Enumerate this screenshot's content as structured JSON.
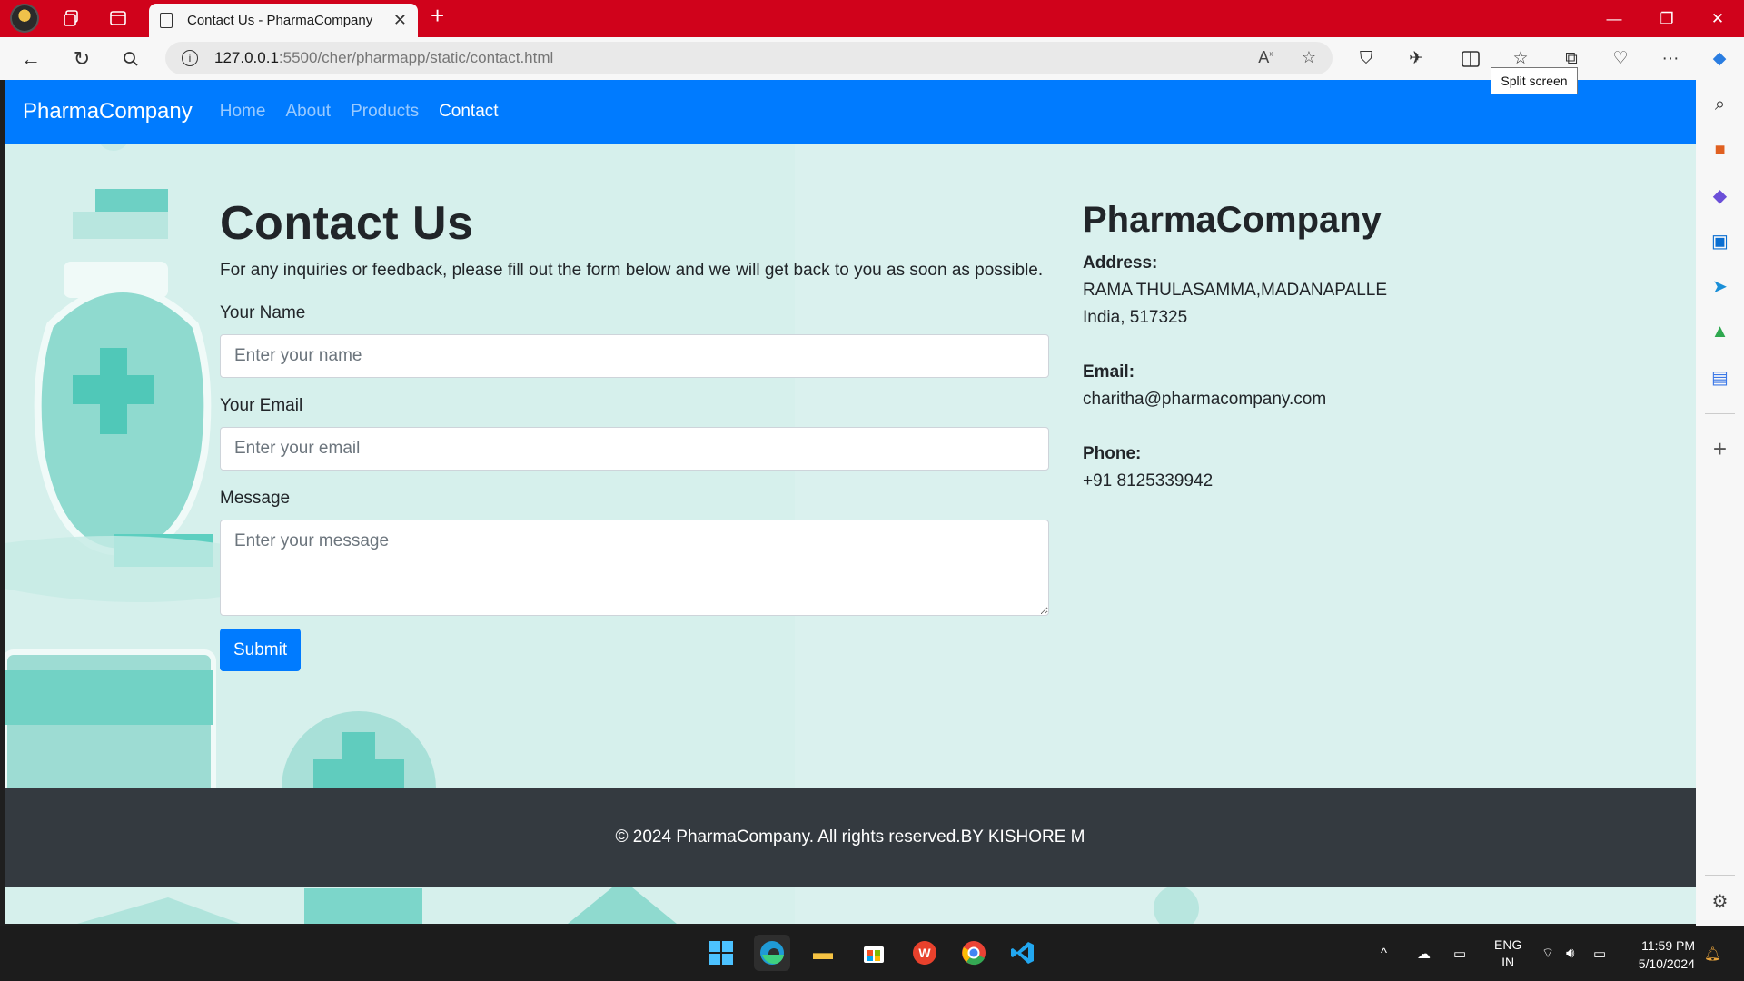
{
  "browser": {
    "tab_title": "Contact Us - PharmaCompany",
    "url_host": "127.0.0.1",
    "url_path": ":5500/cher/pharmapp/static/contact.html",
    "tooltip": "Split screen"
  },
  "navbar": {
    "brand": "PharmaCompany",
    "links": [
      "Home",
      "About",
      "Products",
      "Contact"
    ],
    "active": "Contact"
  },
  "contact_form": {
    "title": "Contact Us",
    "intro": "For any inquiries or feedback, please fill out the form below and we will get back to you as soon as possible.",
    "name_label": "Your Name",
    "name_placeholder": "Enter your name",
    "email_label": "Your Email",
    "email_placeholder": "Enter your email",
    "message_label": "Message",
    "message_placeholder": "Enter your message",
    "submit_label": "Submit"
  },
  "company_info": {
    "name": "PharmaCompany",
    "address_label": "Address:",
    "address_line1": "RAMA THULASAMMA,MADANAPALLE",
    "address_line2": "India, 517325",
    "email_label": "Email:",
    "email": "charitha@pharmacompany.com",
    "phone_label": "Phone:",
    "phone": "+91 8125339942"
  },
  "footer": {
    "text": "© 2024 PharmaCompany. All rights reserved.BY KISHORE M"
  },
  "taskbar": {
    "lang_top": "ENG",
    "lang_bottom": "IN",
    "time": "11:59 PM",
    "date": "5/10/2024"
  },
  "colors": {
    "titlebar": "#d0021b",
    "navbar": "#007bff",
    "page_bg": "#d6f0ec",
    "footer_bg": "#343a40",
    "button": "#007bff"
  }
}
